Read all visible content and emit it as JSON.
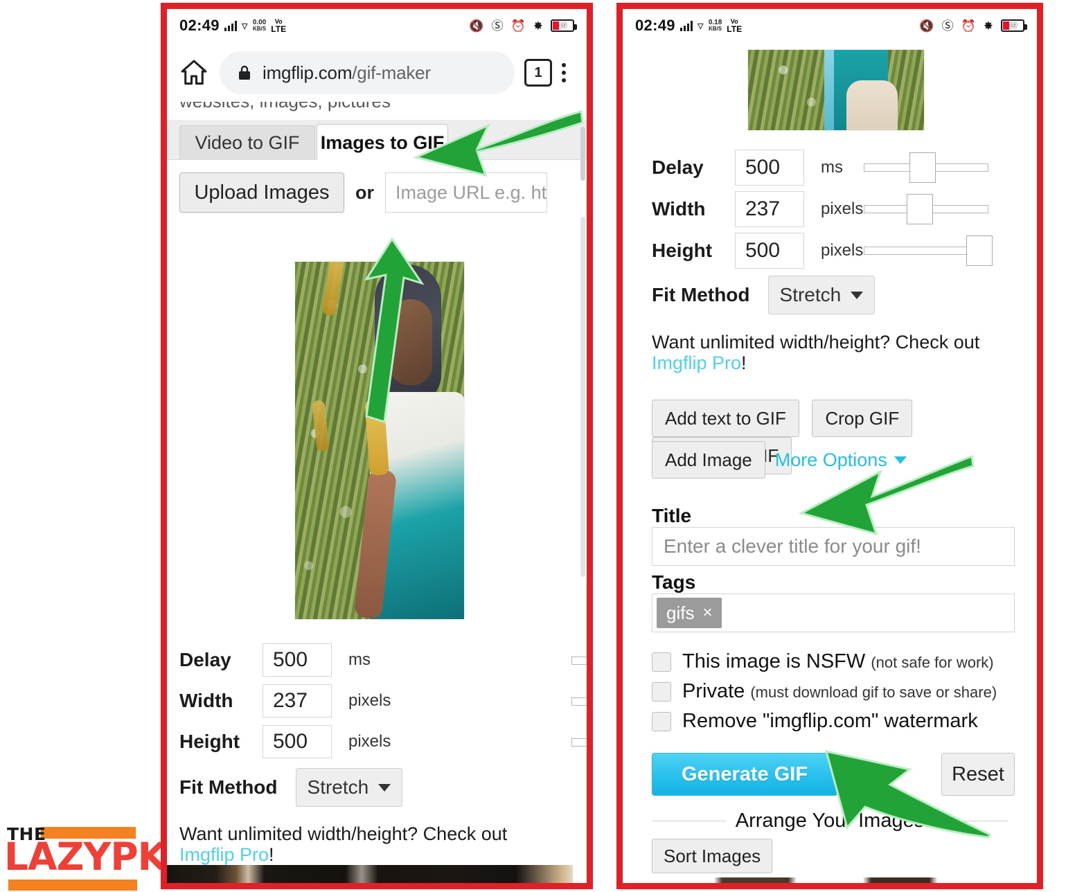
{
  "brand": {
    "the": "THE",
    "name": "LAZYPK"
  },
  "statusbar": {
    "time": "02:49",
    "left_speed_value": "0.00",
    "left_speed_unit": "KB/S",
    "right_speed_value": "0.18",
    "right_speed_unit": "KB/S",
    "network_vo": "Vo",
    "network_lte": "LTE",
    "battery_level": "19",
    "icons": [
      "signal-icon",
      "wifi-icon",
      "data-speed-icon",
      "volte-icon",
      "mute-icon",
      "dnd-icon",
      "alarm-icon",
      "bluetooth-icon",
      "battery-icon"
    ]
  },
  "browser": {
    "home_icon": "home-icon",
    "lock_icon": "lock-icon",
    "url_domain": "imgflip.com",
    "url_path": "/gif-maker",
    "tab_count": "1",
    "menu_icon": "kebab-menu-icon"
  },
  "left": {
    "clipped_text": "websites, images, pictures",
    "tabs": [
      {
        "label": "Video to GIF",
        "active": false
      },
      {
        "label": "Images to GIF",
        "active": true
      }
    ],
    "upload_button": "Upload Images",
    "or_label": "or",
    "image_url_placeholder": "Image URL e.g. ht",
    "form": {
      "delay_label": "Delay",
      "delay_value": "500",
      "delay_unit": "ms",
      "width_label": "Width",
      "width_value": "237",
      "width_unit": "pixels",
      "height_label": "Height",
      "height_value": "500",
      "height_unit": "pixels",
      "fit_label": "Fit Method",
      "fit_value": "Stretch"
    },
    "promo_text": "Want unlimited width/height? Check out",
    "promo_link": "Imgflip Pro",
    "promo_bang": "!"
  },
  "right": {
    "form": {
      "delay_label": "Delay",
      "delay_value": "500",
      "delay_unit": "ms",
      "width_label": "Width",
      "width_value": "237",
      "width_unit": "pixels",
      "height_label": "Height",
      "height_value": "500",
      "height_unit": "pixels",
      "fit_label": "Fit Method",
      "fit_value": "Stretch"
    },
    "promo_text": "Want unlimited width/height? Check out",
    "promo_link": "Imgflip Pro",
    "promo_bang": "!",
    "actions": {
      "add_text": "Add text to GIF",
      "crop": "Crop GIF",
      "rotate": "Rotate GIF",
      "add_image": "Add Image",
      "more_options": "More Options"
    },
    "title_label": "Title",
    "title_placeholder": "Enter a clever title for your gif!",
    "tags_label": "Tags",
    "tag_chip": "gifs",
    "tag_chip_remove": "×",
    "checkboxes": [
      {
        "main": "This image is NSFW",
        "note": "(not safe for work)"
      },
      {
        "main": "Private",
        "note": "(must download gif to save or share)"
      },
      {
        "main": "Remove \"imgflip.com\" watermark",
        "note": ""
      }
    ],
    "generate_button": "Generate GIF",
    "reset_button": "Reset",
    "arrange_heading": "Arrange Your Images",
    "sort_button": "Sort Images"
  },
  "annotations": {
    "arrow_color": "#22a338",
    "arrows": [
      {
        "name": "arrow-to-images-to-gif-tab"
      },
      {
        "name": "arrow-to-upload-images-button"
      },
      {
        "name": "arrow-to-title-field"
      },
      {
        "name": "arrow-to-generate-gif-button"
      }
    ]
  },
  "panel_border_color": "#e01f26"
}
